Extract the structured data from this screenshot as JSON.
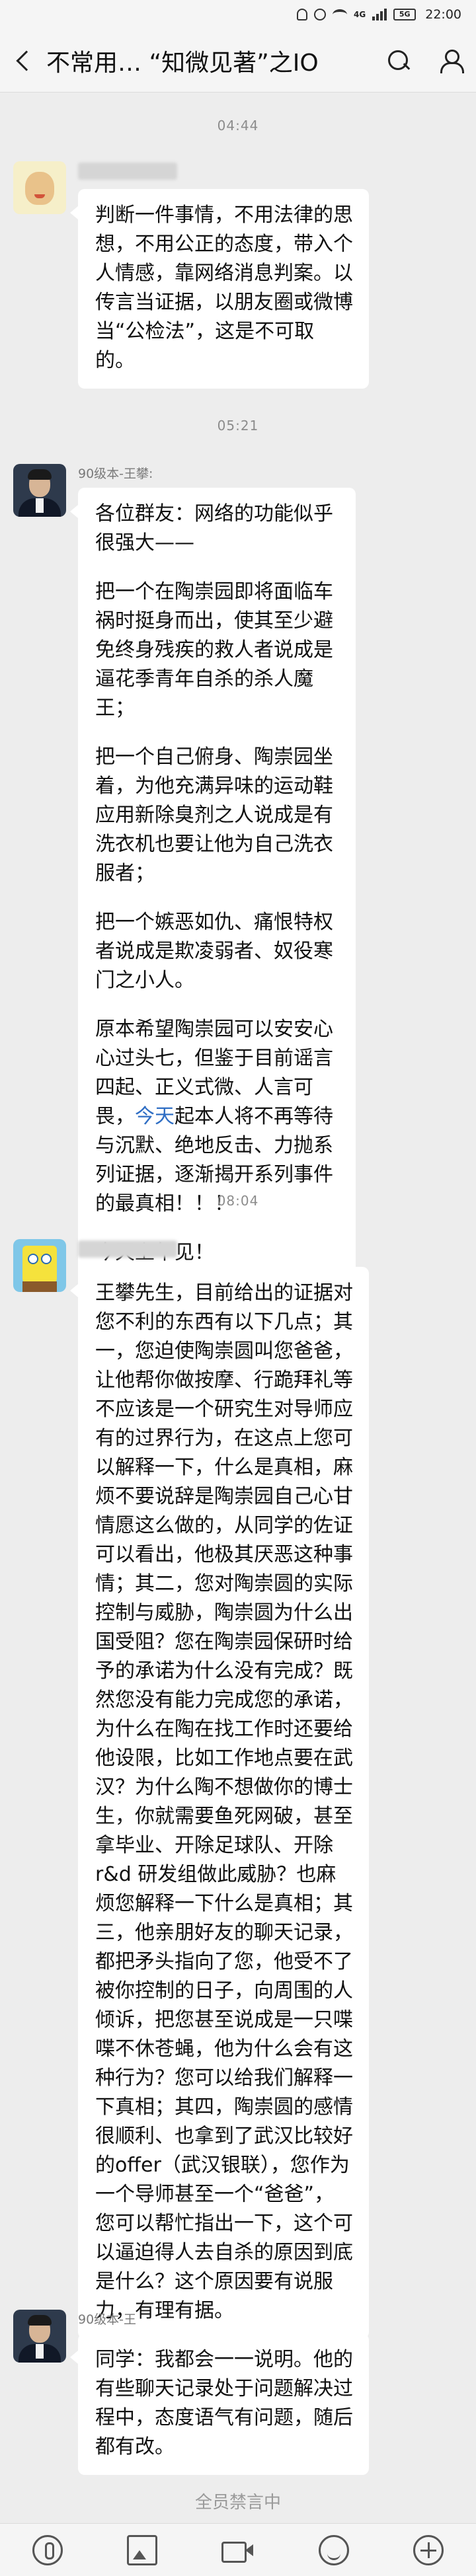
{
  "status_bar": {
    "network": "4G",
    "signal_label": "5G",
    "time": "22:00",
    "icons": [
      "bell-icon",
      "alarm-icon",
      "wifi-icon",
      "signal-icon",
      "battery-icon"
    ]
  },
  "nav": {
    "title": "不常用…  “知微见著”之IO",
    "back_icon": "chevron-left-icon",
    "search_icon": "search-icon",
    "members_icon": "person-icon"
  },
  "messages": [
    {
      "time": "04:44",
      "sender": "",
      "paragraphs": [
        "判断一件事情，不用法律的思想，不用公正的态度，带入个人情感，靠网络消息判案。以传言当证据，以朋友圈或微博当“公检法”，这是不可取的。"
      ]
    },
    {
      "time": "05:21",
      "sender": "90级本-王攀:",
      "paragraphs": [
        "各位群友：网络的功能似乎很强大——",
        "把一个在陶崇园即将面临车祸时挺身而出，使其至少避免终身残疾的救人者说成是逼花季青年自杀的杀人魔王；",
        "把一个自己俯身、陶崇园坐着，为他充满异味的运动鞋应用新除臭剂之人说成是有洗衣机也要让他为自己洗衣服者；",
        "把一个嫉恶如仇、痛恨特权者说成是欺凌弱者、奴役寒门之小人。",
        "原本希望陶崇园可以安安心心过头七，但鉴于目前谣言四起、正义式微、人言可畏，",
        "今天上午见！"
      ],
      "link_text": "今天",
      "link_tail": "起本人将不再等待与沉默、绝地反击、力抛系列证据，逐渐揭开系列事件的最真相！！！"
    },
    {
      "time": "08:04",
      "sender": "",
      "paragraphs": [
        "王攀先生，目前给出的证据对您不利的东西有以下几点；其一，您迫使陶崇圆叫您爸爸，让他帮你做按摩、行跪拜礼等不应该是一个研究生对导师应有的过界行为，在这点上您可以解释一下，什么是真相，麻烦不要说辞是陶崇园自己心甘情愿这么做的，从同学的佐证可以看出，他极其厌恶这种事情；其二，您对陶崇圆的实际控制与威胁，陶崇圆为什么出国受阻？您在陶崇园保研时给予的承诺为什么没有完成？既然您没有能力完成您的承诺，为什么在陶在找工作时还要给他设限，比如工作地点要在武汉？为什么陶不想做你的博士生，你就需要鱼死网破，甚至拿毕业、开除足球队、开除r&d 研发组做此威胁？也麻烦您解释一下什么是真相；其三，他亲朋好友的聊天记录，都把矛头指向了您，他受不了被你控制的日子，向周围的人倾诉，把您甚至说成是一只喋喋不休苍蝇，他为什么会有这种行为？您可以给我们解释一下真相；其四，陶崇圆的感情很顺利、也拿到了武汉比较好的offer（武汉银联），您作为一个导师甚至一个“爸爸”，您可以帮忙指出一下，这个可以逼迫得人去自杀的原因到底是什么？这个原因要有说服力，有理有据。"
      ]
    },
    {
      "time": "",
      "sender": "90级本-王",
      "paragraphs": [
        "同学：我都会一一说明。他的有些聊天记录处于问题解决过程中，态度语气有问题，随后都有改。"
      ]
    }
  ],
  "footer": {
    "muted_notice": "全员禁言中",
    "toolbar_icons": [
      "microphone-icon",
      "image-icon",
      "video-icon",
      "emoji-icon",
      "plus-icon"
    ]
  }
}
